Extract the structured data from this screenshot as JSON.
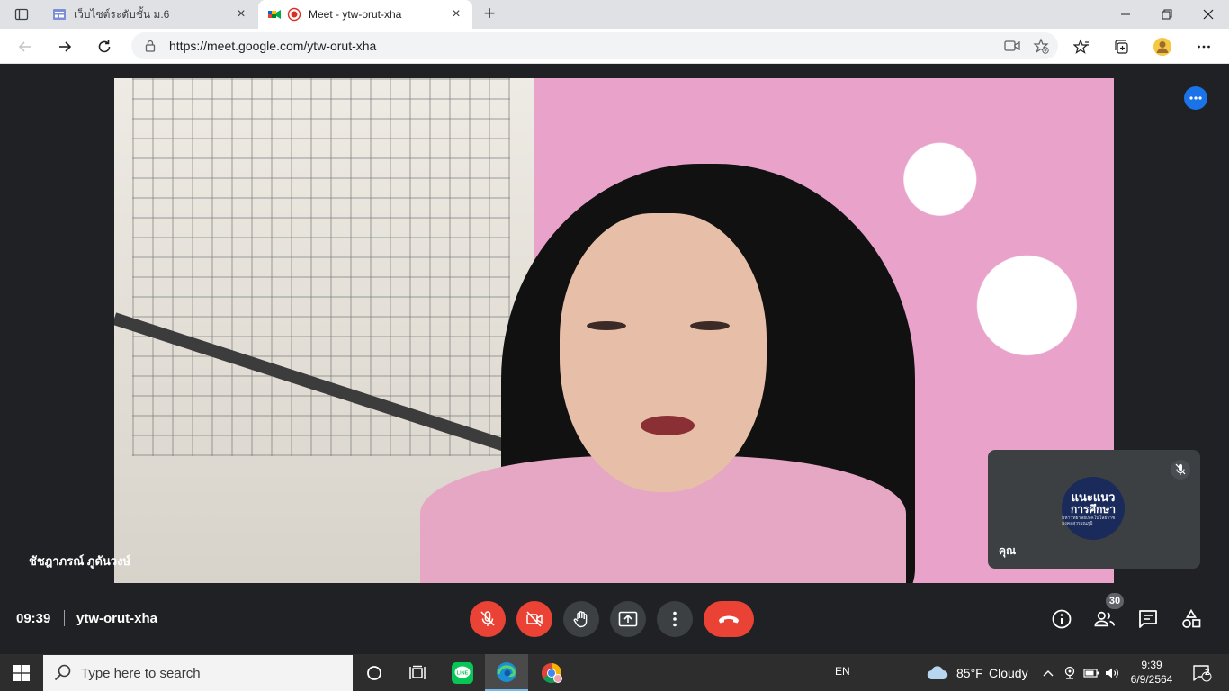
{
  "browser": {
    "tabs": [
      {
        "title": "เว็บไซต์ระดับชั้น ม.6",
        "active": false
      },
      {
        "title": "Meet - ytw-orut-xha",
        "active": true
      }
    ],
    "url": "https://meet.google.com/ytw-orut-xha"
  },
  "meet": {
    "speaker_name": "ชัชฎาภรณ์ ภูดันวงษ์",
    "self_label": "คุณ",
    "self_avatar": {
      "line1": "แนะแนว",
      "line2": "การศึกษา",
      "line3": "มหาวิทยาลัยเทคโนโลยีราชมงคลสุวรรณภูมิ"
    },
    "time": "09:39",
    "meeting_code": "ytw-orut-xha",
    "participants_count": "30",
    "accent_color": "#1a73e8",
    "danger_color": "#ea4335"
  },
  "taskbar": {
    "search_placeholder": "Type here to search",
    "language": "EN",
    "weather_temp": "85°F",
    "weather_desc": "Cloudy",
    "clock_time": "9:39",
    "clock_date": "6/9/2564",
    "notification_count": "2"
  }
}
